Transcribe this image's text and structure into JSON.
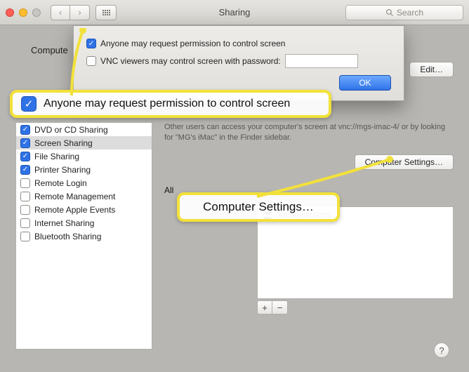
{
  "window": {
    "title": "Sharing",
    "search_placeholder": "Search"
  },
  "toolbar": {
    "back": "‹",
    "forward": "›"
  },
  "computer_label": "Compute",
  "edit_button": "Edit…",
  "sheet": {
    "anyone_label": "Anyone may request permission to control screen",
    "anyone_checked": true,
    "vnc_label": "VNC viewers may control screen with password:",
    "vnc_checked": false,
    "vnc_password": "",
    "ok": "OK"
  },
  "services": [
    {
      "label": "DVD or CD Sharing",
      "on": true,
      "selected": false
    },
    {
      "label": "Screen Sharing",
      "on": true,
      "selected": true
    },
    {
      "label": "File Sharing",
      "on": true,
      "selected": false
    },
    {
      "label": "Printer Sharing",
      "on": true,
      "selected": false
    },
    {
      "label": "Remote Login",
      "on": false,
      "selected": false
    },
    {
      "label": "Remote Management",
      "on": false,
      "selected": false
    },
    {
      "label": "Remote Apple Events",
      "on": false,
      "selected": false
    },
    {
      "label": "Internet Sharing",
      "on": false,
      "selected": false
    },
    {
      "label": "Bluetooth Sharing",
      "on": false,
      "selected": false
    }
  ],
  "right": {
    "info_text": "Other users can access your computer's screen at vnc://mgs-imac-4/ or by looking for \"MG's iMac\" in the Finder sidebar.",
    "computer_settings": "Computer Settings…",
    "allow_prefix": "All",
    "users_list": [
      "Administrators"
    ],
    "add": "+",
    "remove": "−",
    "help": "?"
  },
  "callouts": {
    "c1": "Anyone may request permission to control screen",
    "c2": "Computer Settings…"
  }
}
